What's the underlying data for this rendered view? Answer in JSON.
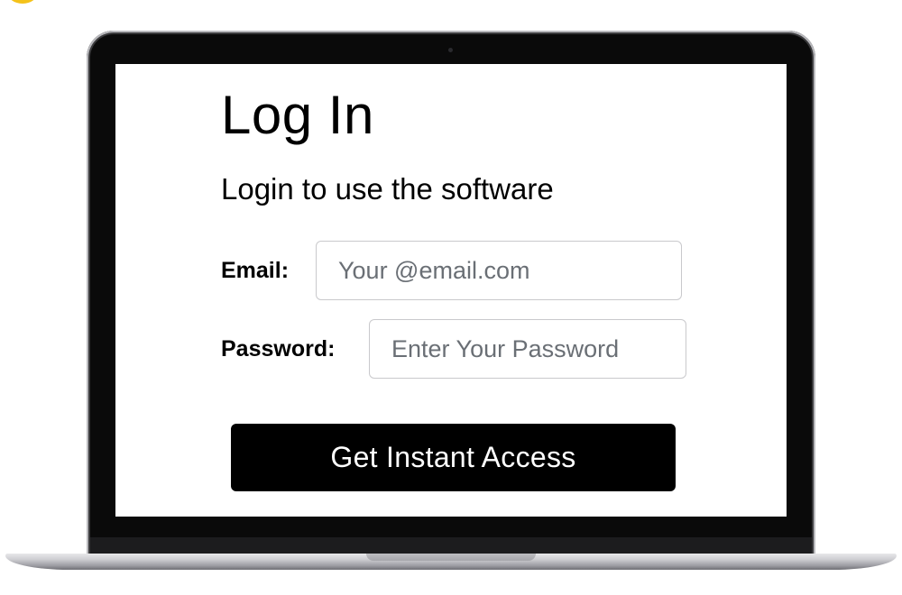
{
  "login": {
    "title": "Log In",
    "subtitle": "Login to use the software",
    "email_label": "Email:",
    "email_placeholder": "Your @email.com",
    "password_label": "Password:",
    "password_placeholder": "Enter Your Password",
    "submit_label": "Get Instant Access"
  },
  "colors": {
    "button_bg": "#000000",
    "button_text": "#ffffff",
    "input_border": "#c9c9cc",
    "placeholder_text": "#6a6f75",
    "accent_dot": "#f4c21a"
  }
}
